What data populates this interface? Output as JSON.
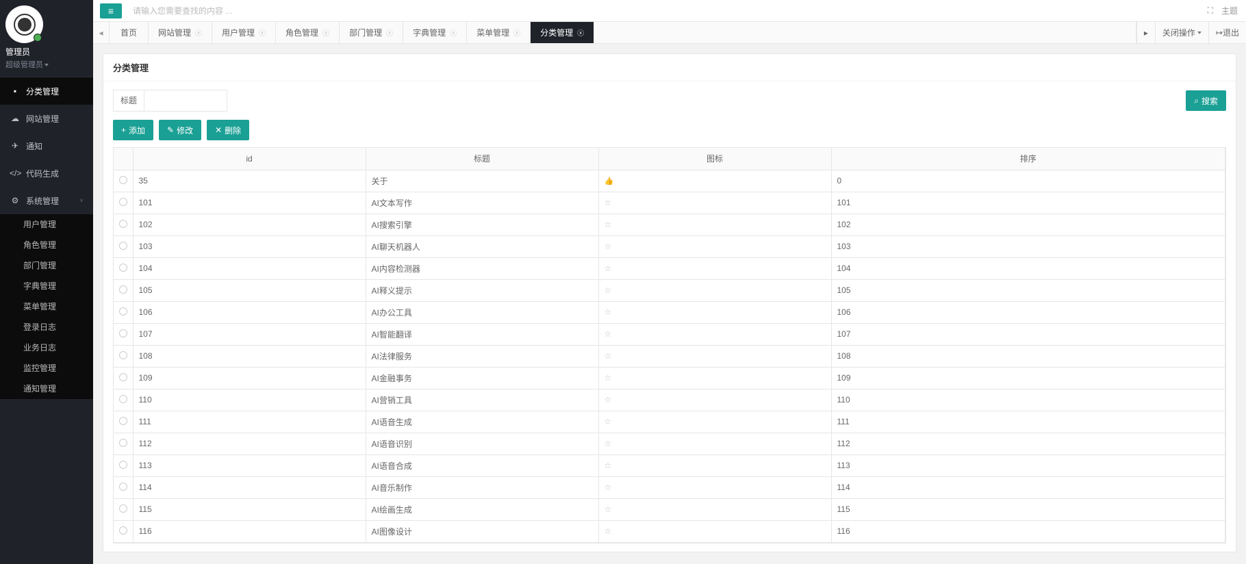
{
  "user": {
    "name": "管理员",
    "role": "超级管理员"
  },
  "search": {
    "placeholder": "请输入您需要查找的内容 ..."
  },
  "topRight": {
    "screen": "⛶",
    "theme": "主题"
  },
  "sidebar": [
    {
      "icon": "▪",
      "label": "分类管理"
    },
    {
      "icon": "☁",
      "label": "网站管理"
    },
    {
      "icon": "✈",
      "label": "通知"
    },
    {
      "icon": "</>",
      "label": "代码生成"
    },
    {
      "icon": "⚙",
      "label": "系统管理",
      "expanded": true,
      "children": [
        {
          "label": "用户管理"
        },
        {
          "label": "角色管理"
        },
        {
          "label": "部门管理"
        },
        {
          "label": "字典管理"
        },
        {
          "label": "菜单管理"
        },
        {
          "label": "登录日志"
        },
        {
          "label": "业务日志"
        },
        {
          "label": "监控管理"
        },
        {
          "label": "通知管理"
        }
      ]
    }
  ],
  "tabs": {
    "home": "首页",
    "items": [
      {
        "label": "网站管理",
        "closable": true
      },
      {
        "label": "用户管理",
        "closable": true
      },
      {
        "label": "角色管理",
        "closable": true
      },
      {
        "label": "部门管理",
        "closable": true
      },
      {
        "label": "字典管理",
        "closable": true
      },
      {
        "label": "菜单管理",
        "closable": true
      },
      {
        "label": "分类管理",
        "closable": true,
        "active": true
      }
    ],
    "closeOps": "关闭操作",
    "logout": "退出"
  },
  "page": {
    "title": "分类管理",
    "searchLabel": "标题",
    "searchBtn": "搜索",
    "addBtn": "添加",
    "editBtn": "修改",
    "delBtn": "删除"
  },
  "columns": {
    "id": "id",
    "title": "标题",
    "icon": "图标",
    "sort": "排序"
  },
  "rows": [
    {
      "id": "35",
      "title": "关于",
      "icon": "thumb",
      "sort": "0"
    },
    {
      "id": "101",
      "title": "AI文本写作",
      "icon": "star",
      "sort": "101"
    },
    {
      "id": "102",
      "title": "AI搜索引擎",
      "icon": "star",
      "sort": "102"
    },
    {
      "id": "103",
      "title": "AI聊天机器人",
      "icon": "star",
      "sort": "103"
    },
    {
      "id": "104",
      "title": "AI内容检测器",
      "icon": "star",
      "sort": "104"
    },
    {
      "id": "105",
      "title": "AI释义提示",
      "icon": "star",
      "sort": "105"
    },
    {
      "id": "106",
      "title": "AI办公工具",
      "icon": "star",
      "sort": "106"
    },
    {
      "id": "107",
      "title": "AI智能翻译",
      "icon": "star",
      "sort": "107"
    },
    {
      "id": "108",
      "title": "AI法律服务",
      "icon": "star",
      "sort": "108"
    },
    {
      "id": "109",
      "title": "AI金融事务",
      "icon": "star",
      "sort": "109"
    },
    {
      "id": "110",
      "title": "AI营销工具",
      "icon": "star",
      "sort": "110"
    },
    {
      "id": "111",
      "title": "AI语音生成",
      "icon": "star",
      "sort": "111"
    },
    {
      "id": "112",
      "title": "AI语音识别",
      "icon": "star",
      "sort": "112"
    },
    {
      "id": "113",
      "title": "AI语音合成",
      "icon": "star",
      "sort": "113"
    },
    {
      "id": "114",
      "title": "AI音乐制作",
      "icon": "star",
      "sort": "114"
    },
    {
      "id": "115",
      "title": "AI绘画生成",
      "icon": "star",
      "sort": "115"
    },
    {
      "id": "116",
      "title": "AI图像设计",
      "icon": "star",
      "sort": "116"
    }
  ]
}
